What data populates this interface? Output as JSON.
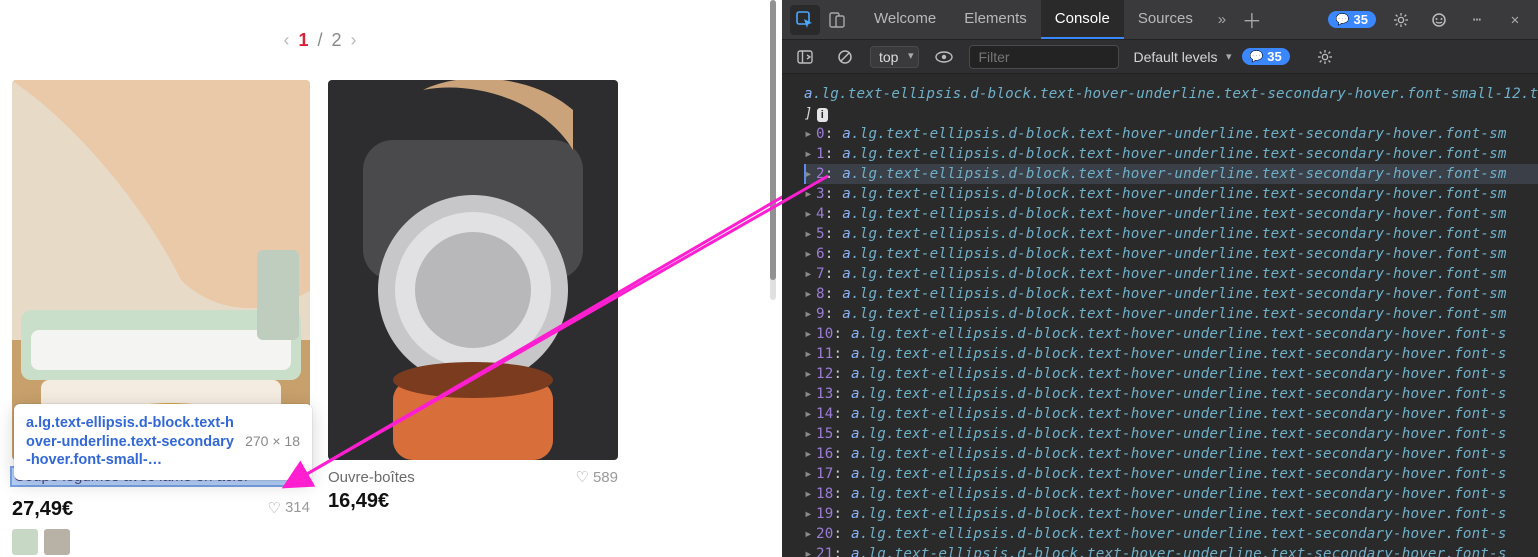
{
  "pager": {
    "prev_icon": "‹",
    "current": "1",
    "sep": "/",
    "total": "2",
    "next_icon": "›"
  },
  "tooltip": {
    "selector": "a.lg.text-ellipsis.d-block.text-hover-underline.text-secondary-hover.font-small-…",
    "dims": "270 × 18"
  },
  "products": [
    {
      "title": "Coupe légumes avec lame en acier",
      "price": "27,49€",
      "likes": "314"
    },
    {
      "title": "Ouvre-boîtes",
      "price": "16,49€",
      "likes": "589"
    }
  ],
  "devtools": {
    "tabs": {
      "welcome": "Welcome",
      "elements": "Elements",
      "console": "Console",
      "sources": "Sources"
    },
    "issues_count": "35",
    "toolbar": {
      "context": "top",
      "filter_placeholder": "Filter",
      "levels": "Default levels",
      "issues_count": "35"
    },
    "log_header": "a.lg.text-ellipsis.d-block.text-hover-underline.text-secondary-hover.font-small-12.t",
    "log_bracket": "]",
    "log_info_badge": "i",
    "log_class_string_short": ".lg.text-ellipsis.d-block.text-hover-underline.text-secondary-hover.font-sm",
    "log_class_string_long": ".lg.text-ellipsis.d-block.text-hover-underline.text-secondary-hover.font-s",
    "log_indices": [
      "0",
      "1",
      "2",
      "3",
      "4",
      "5",
      "6",
      "7",
      "8",
      "9",
      "10",
      "11",
      "12",
      "13",
      "14",
      "15",
      "16",
      "17",
      "18",
      "19",
      "20",
      "21"
    ]
  }
}
